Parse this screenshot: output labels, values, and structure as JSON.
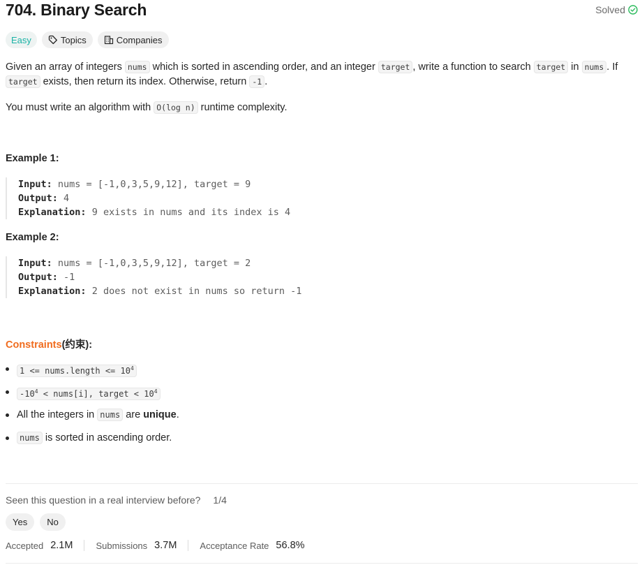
{
  "problem": {
    "title": "704. Binary Search",
    "status": "Solved",
    "difficulty": "Easy",
    "topics_label": "Topics",
    "companies_label": "Companies"
  },
  "description": {
    "p1": {
      "t1": "Given an array of integers ",
      "c1": "nums",
      "t2": " which is sorted in ascending order, and an integer ",
      "c2": "target",
      "t3": ", write a function to search ",
      "c3": "target",
      "t4": " in ",
      "c4": "nums",
      "t5": ". If ",
      "c5": "target",
      "t6": " exists, then return its index. Otherwise, return ",
      "c6": "-1",
      "t7": "."
    },
    "p2": {
      "t1": "You must write an algorithm with ",
      "c1": "O(log n)",
      "t2": " runtime complexity."
    }
  },
  "examples": [
    {
      "title": "Example 1:",
      "input_label": "Input:",
      "input": "nums = [-1,0,3,5,9,12], target = 9",
      "output_label": "Output:",
      "output": "4",
      "explanation_label": "Explanation:",
      "explanation": "9 exists in nums and its index is 4"
    },
    {
      "title": "Example 2:",
      "input_label": "Input:",
      "input": "nums = [-1,0,3,5,9,12], target = 2",
      "output_label": "Output:",
      "output": "-1",
      "explanation_label": "Explanation:",
      "explanation": "2 does not exist in nums so return -1"
    }
  ],
  "constraints": {
    "label": "Constraints",
    "label_suffix": "(约束):",
    "items": [
      {
        "code_a": "1 <= nums.length <= 10",
        "sup": "4"
      },
      {
        "code_a": "-10",
        "sup_a": "4",
        "code_b": " < nums[i], target < 10",
        "sup_b": "4"
      },
      {
        "t1": "All the integers in ",
        "c1": "nums",
        "t2": " are ",
        "b1": "unique",
        "t3": "."
      },
      {
        "c1": "nums",
        "t1": " is sorted in ascending order."
      }
    ]
  },
  "feedback": {
    "question": "Seen this question in a real interview before?",
    "counter": "1/4",
    "yes": "Yes",
    "no": "No"
  },
  "stats": {
    "accepted_label": "Accepted",
    "accepted": "2.1M",
    "submissions_label": "Submissions",
    "submissions": "3.7M",
    "rate_label": "Acceptance Rate",
    "rate": "56.8%"
  },
  "colors": {
    "easy": "#1ab3a6",
    "solved_check": "#2cbb5d",
    "constraints_accent": "#f06c1e"
  },
  "icons": [
    "check-circle-icon",
    "tag-icon",
    "building-icon"
  ]
}
